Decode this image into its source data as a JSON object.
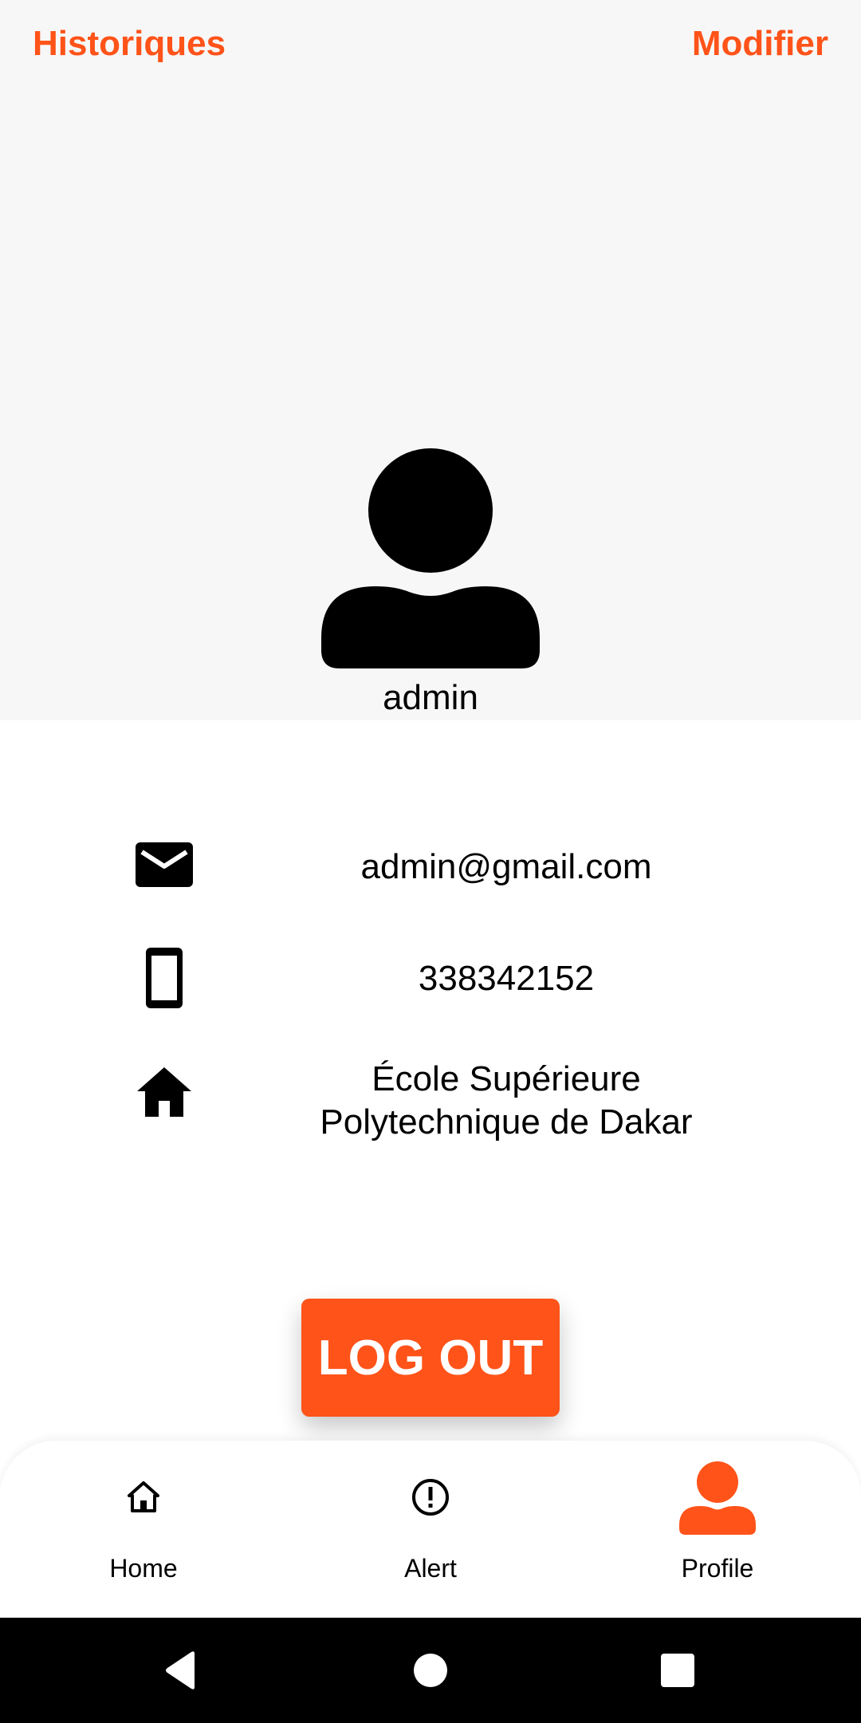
{
  "header": {
    "left_link": "Historiques",
    "right_link": "Modifier"
  },
  "profile": {
    "username": "admin",
    "avatar_icon": "person-icon"
  },
  "info": {
    "email": "admin@gmail.com",
    "phone": "338342152",
    "address_line1": "École Supérieure",
    "address_line2": "Polytechnique de Dakar",
    "icons": [
      "mail-icon",
      "phone-icon",
      "home-icon"
    ]
  },
  "actions": {
    "logout_label": "LOG OUT"
  },
  "nav": {
    "items": [
      {
        "label": "Home",
        "icon": "home-outline-icon"
      },
      {
        "label": "Alert",
        "icon": "alert-circle-icon"
      },
      {
        "label": "Profile",
        "icon": "person-icon",
        "active": true
      }
    ]
  },
  "colors": {
    "accent": "#ff5319",
    "header_bg": "#f7f7f7"
  }
}
